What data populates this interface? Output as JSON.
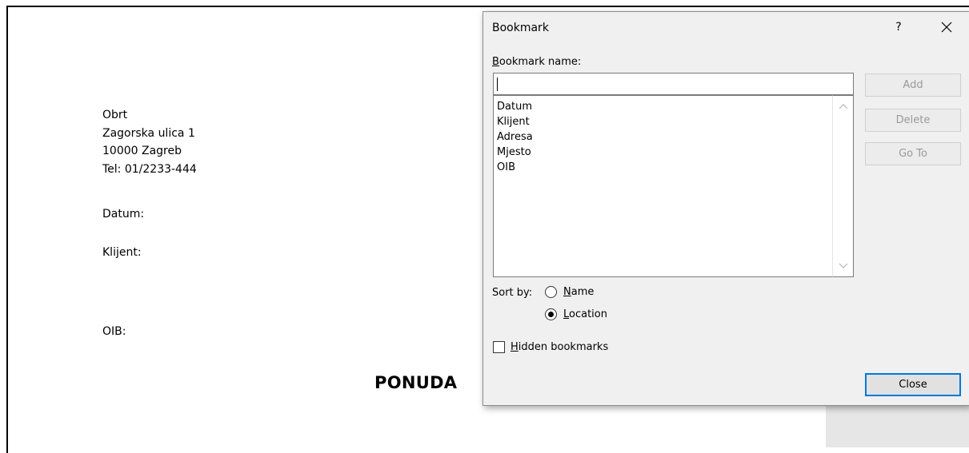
{
  "document": {
    "address_lines": [
      "Obrt",
      "Zagorska ulica 1",
      "10000 Zagreb",
      "Tel: 01/2233-444"
    ],
    "datum_label": "Datum:",
    "klijent_label": "Klijent:",
    "oib_label": "OIB:",
    "title": "PONUDA"
  },
  "dialog": {
    "title": "Bookmark",
    "help_label": "?",
    "close_icon": "close-icon",
    "name_label": "Bookmark name:",
    "name_label_accesskey": "B",
    "name_value": "",
    "bookmarks": [
      "Datum",
      "Klijent",
      "Adresa",
      "Mjesto",
      "OIB"
    ],
    "buttons": {
      "add": "Add",
      "delete": "Delete",
      "goto": "Go To",
      "close": "Close"
    },
    "sort_by_label": "Sort by:",
    "sort_options": [
      {
        "label": "Name",
        "accesskey": "N",
        "checked": false
      },
      {
        "label": "Location",
        "accesskey": "L",
        "checked": true
      }
    ],
    "hidden_bookmarks": {
      "label": "Hidden bookmarks",
      "accesskey": "H",
      "checked": false
    }
  }
}
